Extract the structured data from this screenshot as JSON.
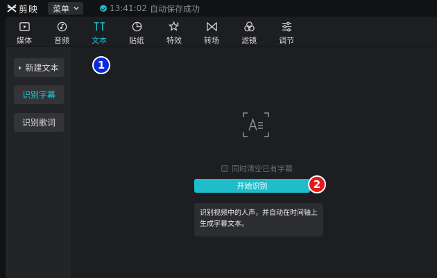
{
  "app": {
    "name": "剪映"
  },
  "menu": {
    "label": "菜单"
  },
  "status": {
    "time": "13:41:02",
    "text": "自动保存成功",
    "accent": "#15bdc9"
  },
  "toolbar": {
    "items": [
      {
        "label": "媒体",
        "icon": "media-icon"
      },
      {
        "label": "音频",
        "icon": "audio-icon"
      },
      {
        "label": "文本",
        "icon": "text-icon",
        "active": true
      },
      {
        "label": "贴纸",
        "icon": "sticker-icon"
      },
      {
        "label": "特效",
        "icon": "effects-icon"
      },
      {
        "label": "转场",
        "icon": "transition-icon"
      },
      {
        "label": "滤镜",
        "icon": "filter-icon"
      },
      {
        "label": "调节",
        "icon": "adjust-icon"
      }
    ]
  },
  "sidebar": {
    "items": [
      {
        "label": "新建文本"
      },
      {
        "label": "识别字幕",
        "active": true
      },
      {
        "label": "识别歌词"
      }
    ]
  },
  "content": {
    "clear_option": "同时清空已有字幕",
    "start_button": "开始识别",
    "tooltip": "识别视频中的人声，并自动在时间轴上生成字幕文本。"
  },
  "annotations": {
    "marker_1": "1",
    "marker_2": "2"
  }
}
